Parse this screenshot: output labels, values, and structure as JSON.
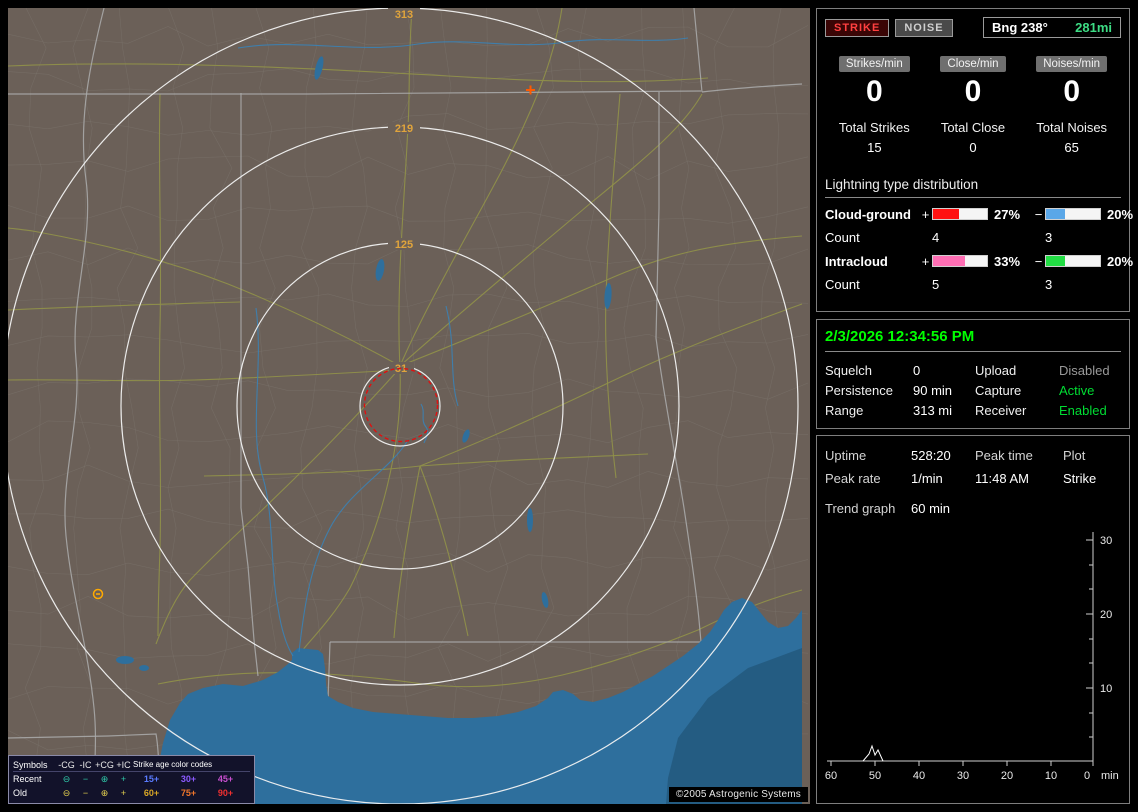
{
  "map": {
    "ring_labels": [
      "313",
      "219",
      "125",
      "31"
    ],
    "copyright": "©2005 Astrogenic Systems"
  },
  "legend": {
    "symbols_title": "Symbols",
    "columns": [
      "-CG",
      "-IC",
      "+CG",
      "+IC"
    ],
    "age_title": "Strike age color codes",
    "recent": {
      "label": "Recent",
      "color": "#2fc8a8",
      "symbols": [
        "⊖",
        "−",
        "⊕",
        "+"
      ],
      "ages": [
        {
          "text": "15+",
          "color": "#5a7bff"
        },
        {
          "text": "30+",
          "color": "#8c5aff"
        },
        {
          "text": "45+",
          "color": "#c94fd0"
        }
      ]
    },
    "old": {
      "label": "Old",
      "color": "#e0cd4e",
      "symbols": [
        "⊖",
        "−",
        "⊕",
        "+"
      ],
      "ages": [
        {
          "text": "60+",
          "color": "#d9a726"
        },
        {
          "text": "75+",
          "color": "#f2762a"
        },
        {
          "text": "90+",
          "color": "#f03030"
        }
      ]
    }
  },
  "panel": {
    "strike_btn": "STRIKE",
    "noise_btn": "NOISE",
    "bearing": {
      "label": "Bng 238°",
      "value": "281mi"
    },
    "counters": [
      {
        "caption": "Strikes/min",
        "rate": "0",
        "total_label": "Total Strikes",
        "total": "15"
      },
      {
        "caption": "Close/min",
        "rate": "0",
        "total_label": "Total Close",
        "total": "0"
      },
      {
        "caption": "Noises/min",
        "rate": "0",
        "total_label": "Total Noises",
        "total": "65"
      }
    ],
    "distribution": {
      "title": "Lightning type distribution",
      "rows": [
        {
          "label": "Cloud-ground",
          "plus": "+",
          "minus": "−",
          "pos_pct": "27%",
          "pos_color": "#ff1111",
          "neg_pct": "20%",
          "neg_color": "#5aa7e8",
          "count_label": "Count",
          "pos_count": "4",
          "neg_count": "3"
        },
        {
          "label": "Intracloud",
          "plus": "+",
          "minus": "−",
          "pos_pct": "33%",
          "pos_color": "#ff6eb4",
          "neg_pct": "20%",
          "neg_color": "#22dd44",
          "count_label": "Count",
          "pos_count": "5",
          "neg_count": "3"
        }
      ]
    },
    "status": {
      "timestamp": "2/3/2026 12:34:56 PM",
      "rows": [
        {
          "k1": "Squelch",
          "v1": "0",
          "k2": "Upload",
          "v2": "Disabled"
        },
        {
          "k1": "Persistence",
          "v1": "90 min",
          "k2": "Capture",
          "v2": "Active"
        },
        {
          "k1": "Range",
          "v1": "313 mi",
          "k2": "Receiver",
          "v2": "Enabled"
        }
      ]
    },
    "stats": {
      "row1": [
        "Uptime",
        "528:20",
        "Peak time",
        "Plot"
      ],
      "row2": [
        "Peak rate",
        "1/min",
        "11:48 AM",
        "Strike"
      ],
      "trend_label": "Trend graph",
      "trend_value": "60 min"
    }
  },
  "chart_data": {
    "type": "line",
    "title": "Trend graph",
    "x_ticks": [
      "60",
      "50",
      "40",
      "30",
      "20",
      "10",
      "0"
    ],
    "x_unit": "min",
    "y_ticks": [
      "30",
      "20",
      "10"
    ],
    "ylim": [
      0,
      30
    ],
    "series": [
      {
        "name": "Strike",
        "points_min_ago_value": [
          [
            60,
            0
          ],
          [
            53,
            0
          ],
          [
            51,
            2
          ],
          [
            50,
            3
          ],
          [
            49,
            1
          ],
          [
            48,
            2
          ],
          [
            46,
            0
          ],
          [
            40,
            0
          ],
          [
            30,
            0
          ],
          [
            20,
            0
          ],
          [
            10,
            0
          ],
          [
            0,
            0
          ]
        ]
      }
    ],
    "legend_position": "none",
    "grid": false
  }
}
